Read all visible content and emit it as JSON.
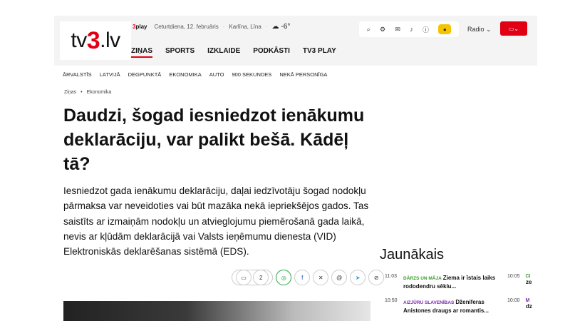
{
  "header": {
    "logo_text_a": "tv",
    "logo_text_b": "3",
    "logo_text_c": ".lv",
    "play_label": "play",
    "date": "Ceturtdiena, 12. februāris",
    "names": "Karlīna, Līna",
    "temperature": "-6°",
    "radio_label": "Radio",
    "colors": {
      "accent": "#e10013",
      "user": "#f5c400"
    }
  },
  "nav": {
    "main": [
      "ZIŅAS",
      "SPORTS",
      "IZKLAIDE",
      "PODKĀSTI",
      "TV3 PLAY"
    ],
    "sub": [
      "ĀRVALSTĪS",
      "LATVIJĀ",
      "DEGPUNKTĀ",
      "EKONOMIKA",
      "AUTO",
      "900 SEKUNDES",
      "NEKĀ PERSONĪGA"
    ]
  },
  "breadcrumb": [
    "Ziņas",
    "Ekonomika"
  ],
  "article": {
    "title": "Daudzi, šogad iesniedzot ienākumu deklarāciju, var palikt bešā. Kādēļ tā?",
    "lead": "Iesniedzot gada ienākumu deklarāciju, daļai iedzīvotāju šogad nodokļu pārmaksa var neveidoties vai būt mazāka nekā iepriekšējos gados. Tas saistīts ar izmaiņām nodokļu un atvieglojumu piemērošanā gada laikā, nevis ar kļūdām deklarācijā vai Valsts ieņēmumu dienesta (VID) Elektroniskās deklarēšanas sistēmā (EDS).",
    "comments_count": "2"
  },
  "sidebar": {
    "title": "Jaunākais",
    "items": [
      {
        "time": "11:03",
        "category": "DĀRZS UN MĀJA",
        "headline": "Ziema ir īstais laiks rododendru sēklu..."
      },
      {
        "time": "10:50",
        "category": "AIZJŪRU SLAVENĪBAS",
        "headline": "Dženiferas Anistones draugs ar romantis..."
      }
    ],
    "col2": [
      {
        "time": "10:05",
        "tag": "CI",
        "tail": "ze"
      },
      {
        "time": "10:00",
        "tag": "M",
        "tail": "dz"
      }
    ]
  }
}
